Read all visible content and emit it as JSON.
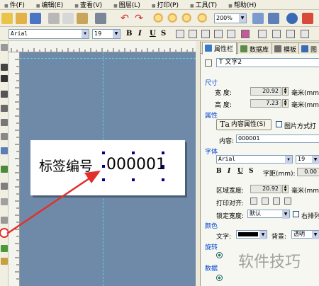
{
  "menu": [
    {
      "label": "件(F)"
    },
    {
      "label": "编辑(E)"
    },
    {
      "label": "查看(V)"
    },
    {
      "label": "图层(L)"
    },
    {
      "label": "打印(P)"
    },
    {
      "label": "工具(T)"
    },
    {
      "label": "帮助(H)"
    }
  ],
  "toolbar": {
    "zoom": "200%"
  },
  "format_bar": {
    "font": "Arial",
    "size": "19",
    "bold": "B",
    "italic": "I",
    "underline": "U",
    "strike": "S"
  },
  "canvas": {
    "label_text": "标签编号",
    "label_value": "000001"
  },
  "panel": {
    "tabs": [
      "属性栏",
      "数据库",
      "模板",
      "图"
    ],
    "object": "T 文字2",
    "size_section": "尺寸",
    "width_label": "宽    度:",
    "width_value": "20.92",
    "width_unit": "毫米(mm)",
    "height_label": "高    度:",
    "height_value": "7.23",
    "height_unit": "毫米(mm)",
    "attr_section": "属性",
    "content_attr_button": "内容属性(S)",
    "image_checkbox": "图片方式打",
    "content_label": "内容:",
    "content_value": "000001",
    "font_section": "字体",
    "font_value": "Arial",
    "font_size": "19",
    "spacing_label": "字距(mm):",
    "spacing_value": "0.00",
    "region_width_label": "区域宽度:",
    "region_width_value": "20.92",
    "region_width_unit": "毫米(mm)",
    "align_label": "打印对齐:",
    "lock_width_label": "锁定宽度:",
    "lock_width_value": "默认",
    "right_align_checkbox": "右排列",
    "color_section": "颜色",
    "text_color_label": "文字:",
    "bg_label": "背景:",
    "bg_value": "透明",
    "rotate_section": "旋转",
    "data_section": "数据"
  },
  "watermark": "软件技巧",
  "colors": {
    "canvas_bg": "#6e8aa8",
    "arrow": "#e0302c",
    "section_blue": "#0046d5"
  }
}
